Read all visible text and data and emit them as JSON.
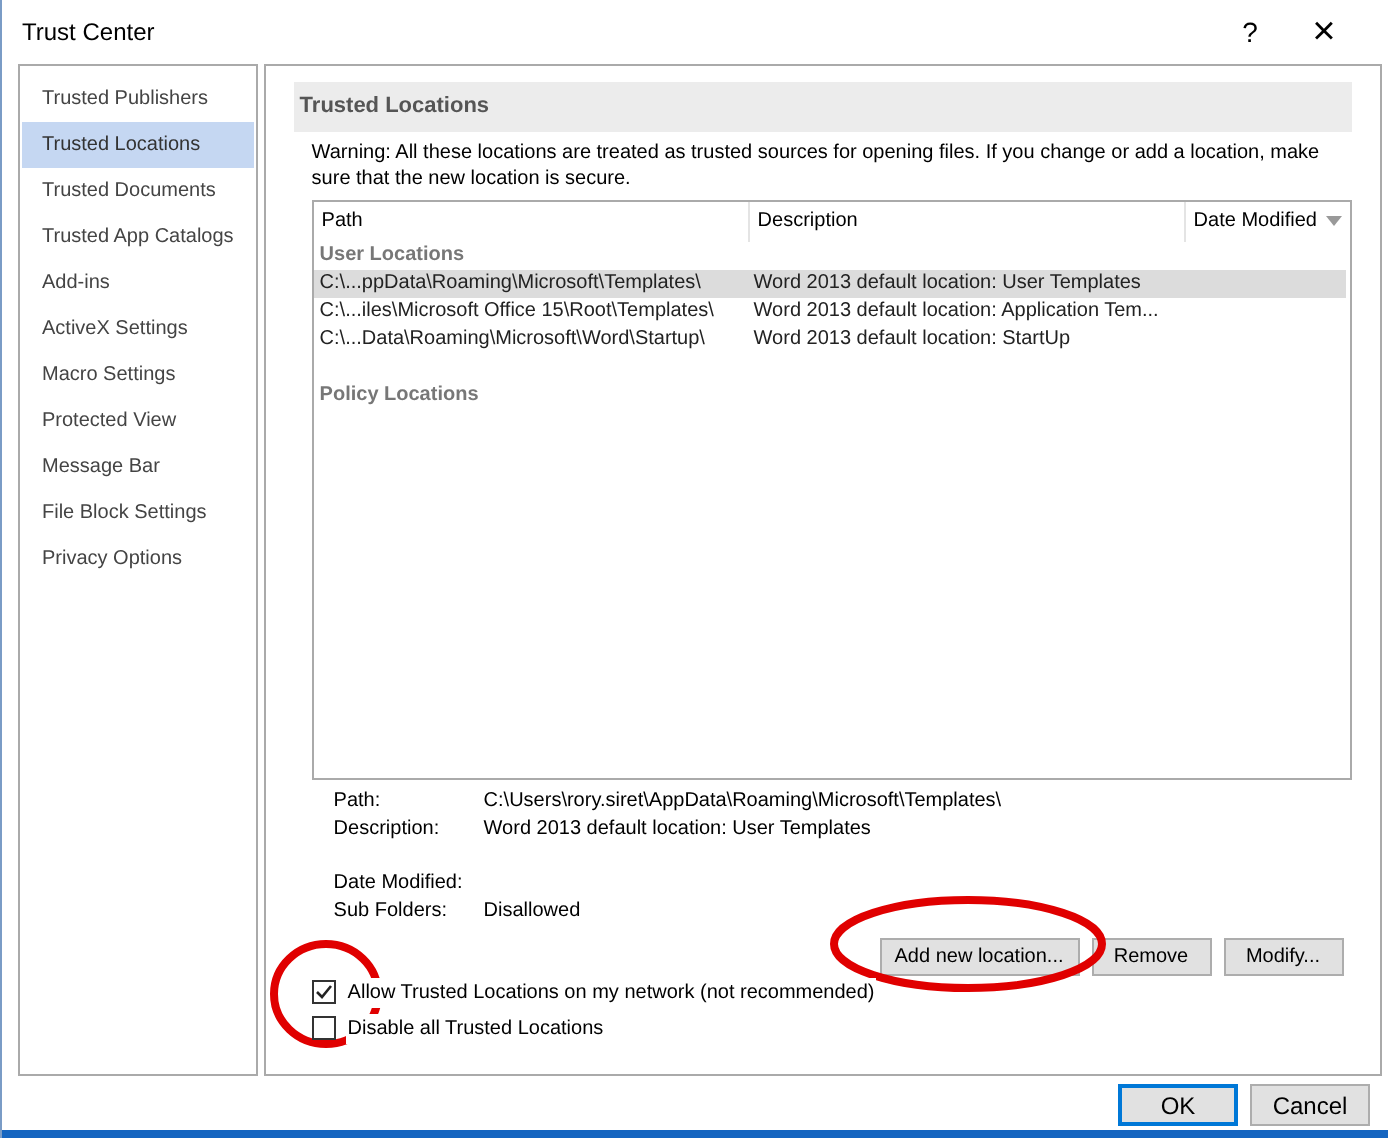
{
  "window": {
    "title": "Trust Center",
    "help": "?",
    "close": "×"
  },
  "sidebar": {
    "items": [
      {
        "label": "Trusted Publishers",
        "selected": false
      },
      {
        "label": "Trusted Locations",
        "selected": true
      },
      {
        "label": "Trusted Documents",
        "selected": false
      },
      {
        "label": "Trusted App Catalogs",
        "selected": false
      },
      {
        "label": "Add-ins",
        "selected": false
      },
      {
        "label": "ActiveX Settings",
        "selected": false
      },
      {
        "label": "Macro Settings",
        "selected": false
      },
      {
        "label": "Protected View",
        "selected": false
      },
      {
        "label": "Message Bar",
        "selected": false
      },
      {
        "label": "File Block Settings",
        "selected": false
      },
      {
        "label": "Privacy Options",
        "selected": false
      }
    ]
  },
  "section_title": "Trusted Locations",
  "warning": "Warning: All these locations are treated as trusted sources for opening files.  If you change or add a location, make sure that the new location is secure.",
  "table": {
    "columns": [
      "Path",
      "Description",
      "Date Modified"
    ],
    "groups": [
      {
        "title": "User Locations",
        "rows": [
          {
            "path": "C:\\...ppData\\Roaming\\Microsoft\\Templates\\",
            "description": "Word 2013 default location: User Templates",
            "selected": true
          },
          {
            "path": "C:\\...iles\\Microsoft Office 15\\Root\\Templates\\",
            "description": "Word 2013 default location: Application Tem...",
            "selected": false
          },
          {
            "path": "C:\\...Data\\Roaming\\Microsoft\\Word\\Startup\\",
            "description": "Word 2013 default location: StartUp",
            "selected": false
          }
        ]
      },
      {
        "title": "Policy Locations"
      }
    ]
  },
  "details": [
    {
      "label": "Path:",
      "value": "C:\\Users\\rory.siret\\AppData\\Roaming\\Microsoft\\Templates\\"
    },
    {
      "label": "Description:",
      "value": "Word 2013 default location: User Templates"
    },
    {
      "label": "Date Modified:"
    },
    {
      "label": "Sub Folders:",
      "value": "Disallowed"
    }
  ],
  "actions": [
    "Add new location...",
    "Remove",
    "Modify..."
  ],
  "options": [
    {
      "label": "Allow Trusted Locations on my network (not recommended)",
      "checked": true
    },
    {
      "label": "Disable all Trusted Locations",
      "checked": false
    }
  ],
  "footer_buttons": [
    {
      "label": "OK",
      "default": true
    },
    {
      "label": "Cancel",
      "default": false
    }
  ]
}
